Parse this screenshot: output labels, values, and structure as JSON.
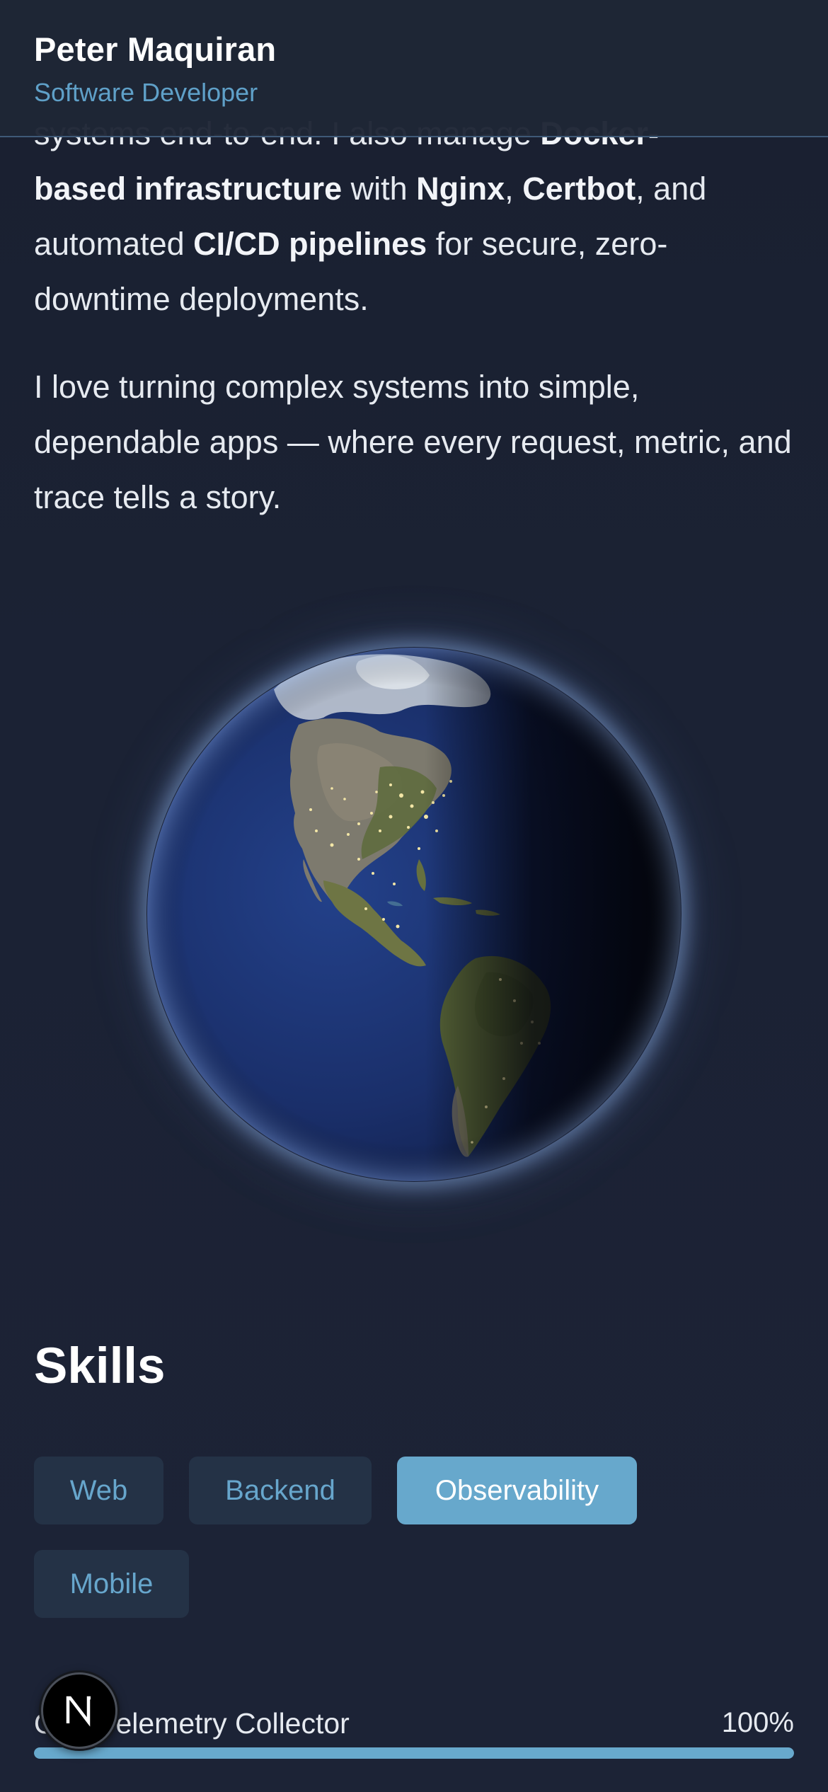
{
  "header": {
    "name": "Peter Maquiran",
    "role": "Software Developer"
  },
  "bio": {
    "p1": {
      "l1_text1": "systems end-to-end. I also manage ",
      "l1_bold1": "Docker-",
      "l2_bold1": "based infrastructure",
      "l2_text1": " with ",
      "l2_bold2": "Nginx",
      "l2_text2": ", ",
      "l2_bold3": "Certbot",
      "l2_text3": ", and",
      "l3_text1": "automated ",
      "l3_bold1": "CI/CD pipelines",
      "l3_text2": " for secure, zero-",
      "l4_text1": "downtime deployments."
    },
    "p2": "I love turning complex systems into simple, dependable apps — where every request, metric, and trace tells a story."
  },
  "skills": {
    "title": "Skills",
    "chips": [
      {
        "label": "Web",
        "active": false
      },
      {
        "label": "Backend",
        "active": false
      },
      {
        "label": "Observability",
        "active": true
      },
      {
        "label": "Mobile",
        "active": false
      }
    ],
    "items": [
      {
        "name": "OTel Telemetry Collector",
        "percent_label": "100%",
        "level": 1.0
      }
    ]
  },
  "badge": {
    "letter": "N",
    "icon": "nextjs-logo-icon"
  },
  "colors": {
    "background": "#1b2233",
    "accent": "#67a8cc",
    "chip_bg": "#243246",
    "text": "#e6eaf0"
  }
}
